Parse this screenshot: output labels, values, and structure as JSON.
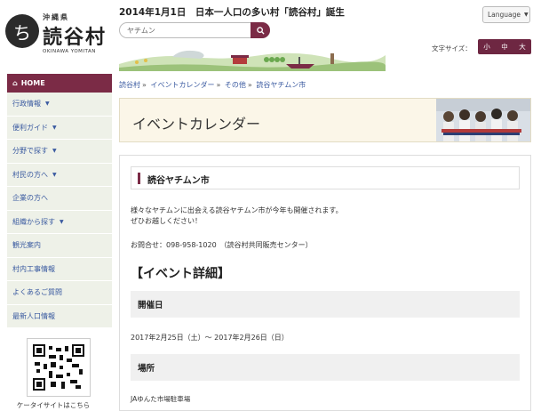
{
  "header": {
    "logo_small": "沖縄県",
    "logo_big": "読谷村",
    "logo_en": "OKINAWA YOMITAN",
    "headline": "2014年1月1日　日本一人口の多い村「読谷村」誕生",
    "search_value": "ヤチムン",
    "language_label": "Language",
    "fontsize_label": "文字サイズ：",
    "fontsize_small": "小",
    "fontsize_medium": "中",
    "fontsize_large": "大"
  },
  "sidebar": {
    "home_label": "HOME",
    "items": [
      {
        "label": "行政情報",
        "has_arrow": true
      },
      {
        "label": "便利ガイド",
        "has_arrow": true
      },
      {
        "label": "分野で探す",
        "has_arrow": true
      },
      {
        "label": "村民の方へ",
        "has_arrow": true
      },
      {
        "label": "企業の方へ",
        "has_arrow": false
      },
      {
        "label": "組織から探す",
        "has_arrow": true
      },
      {
        "label": "観光案内",
        "has_arrow": false
      },
      {
        "label": "村内工事情報",
        "has_arrow": false
      },
      {
        "label": "よくあるご質問",
        "has_arrow": false
      },
      {
        "label": "最新人口情報",
        "has_arrow": false
      }
    ],
    "qr_caption": "ケータイサイトはこちら"
  },
  "breadcrumb": [
    "読谷村",
    "イベントカレンダー",
    "その他",
    "読谷ヤチムン市"
  ],
  "page": {
    "title": "イベントカレンダー",
    "event_title": "読谷ヤチムン市",
    "desc_line1": "様々なヤチムンに出会える読谷ヤチムン市が今年も開催されます。",
    "desc_line2": "ぜひお越しください！",
    "contact": "お問合せ：098-958-1020　（読谷村共同販売センター）",
    "section_head": "【イベント詳細】",
    "sub_date": "開催日",
    "date_text": "2017年2月25日（土）～ 2017年2月26日（日）",
    "sub_place": "場所",
    "place_text": "JAゆんた市場駐車場"
  },
  "colors": {
    "accent": "#7b2b46",
    "nav_bg": "#eef1e8",
    "link": "#3a5aa0"
  }
}
